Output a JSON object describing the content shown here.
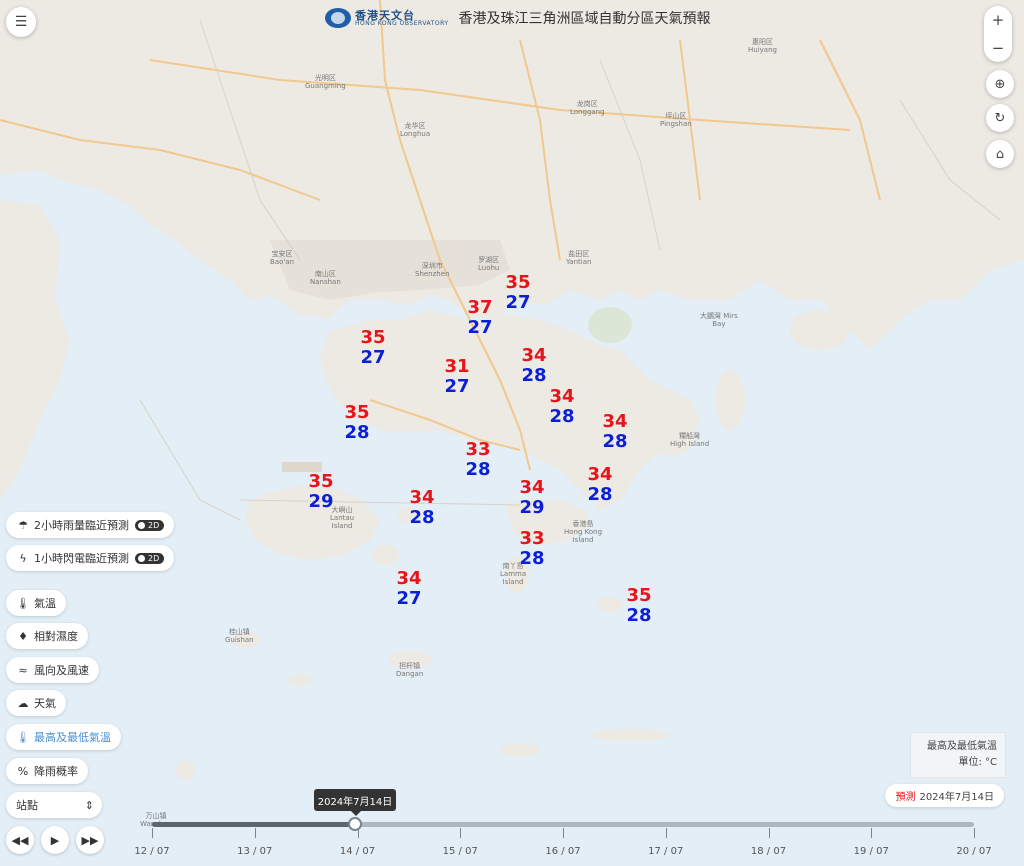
{
  "header": {
    "logo_cn": "香港天文台",
    "logo_en": "HONG KONG OBSERVATORY",
    "title": "香港及珠江三角洲區域自動分區天氣預報"
  },
  "map_controls": {
    "zoom_in": "+",
    "zoom_out": "−"
  },
  "layers": [
    {
      "label": "2小時雨量臨近預測",
      "toggle": "2D",
      "icon": "rain-cloud-icon"
    },
    {
      "label": "1小時閃電臨近預測",
      "toggle": "2D",
      "icon": "lightning-icon"
    },
    {
      "label": "氣溫",
      "icon": "thermometer-icon"
    },
    {
      "label": "相對濕度",
      "icon": "water-drop-icon"
    },
    {
      "label": "風向及風速",
      "icon": "wind-icon"
    },
    {
      "label": "天氣",
      "icon": "weather-cloud-icon"
    },
    {
      "label": "最高及最低氣溫",
      "icon": "max-min-temp-icon",
      "active": true
    },
    {
      "label": "降雨概率",
      "icon": "percent-icon"
    }
  ],
  "station_select": {
    "value": "站點"
  },
  "legend": {
    "line1": "最高及最低氣溫",
    "line2": "單位: °C"
  },
  "forecast": {
    "tag": "預測",
    "date": "2024年7月14日"
  },
  "timeline": {
    "tooltip": "2024年7月14日",
    "dates": [
      "12 / 07",
      "13 / 07",
      "14 / 07",
      "15 / 07",
      "16 / 07",
      "17 / 07",
      "18 / 07",
      "19 / 07",
      "20 / 07"
    ],
    "position": 0.247
  },
  "temperatures": [
    {
      "max": "35",
      "min": "27"
    },
    {
      "max": "37",
      "min": "27"
    },
    {
      "max": "35",
      "min": "27"
    },
    {
      "max": "31",
      "min": "27"
    },
    {
      "max": "34",
      "min": "28"
    },
    {
      "max": "35",
      "min": "28"
    },
    {
      "max": "34",
      "min": "28"
    },
    {
      "max": "34",
      "min": "28"
    },
    {
      "max": "33",
      "min": "28"
    },
    {
      "max": "35",
      "min": "29"
    },
    {
      "max": "34",
      "min": "28"
    },
    {
      "max": "34",
      "min": "29"
    },
    {
      "max": "34",
      "min": "28"
    },
    {
      "max": "33",
      "min": "28"
    },
    {
      "max": "34",
      "min": "27"
    },
    {
      "max": "35",
      "min": "28"
    }
  ],
  "places": {
    "guangming": "光明区\nGuangming",
    "longhua": "龙华区\nLonghua",
    "longgang": "龙岗区\nLonggang",
    "pingshan": "坪山区\nPingshan",
    "huiyang": "惠阳区\nHuiyang",
    "baoan": "宝安区\nBao'an",
    "nanshan": "南山区\nNanshan",
    "shenzhen": "深圳市\nShenzhen",
    "luohu": "罗湖区\nLuohu",
    "yantian": "盐田区\nYantian",
    "mirs_bay": "大鵬灣 Mirs\nBay",
    "lantau": "大嶼山\nLantau\nIsland",
    "hk_island": "香港島\nHong Kong\nIsland",
    "lamma": "南丫島\nLamma\nIsland",
    "guishan": "桂山镇\nGuishan",
    "dangan": "担杆镇\nDangan",
    "wanshan": "万山镇\nWanshan",
    "high_island": "糧船灣\nHigh Island"
  }
}
